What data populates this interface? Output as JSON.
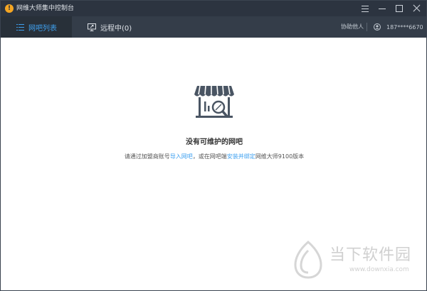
{
  "window": {
    "title": "网维大师集中控制台"
  },
  "tabs": [
    {
      "label": "网吧列表",
      "active": true
    },
    {
      "label": "远程中(0)",
      "active": false
    }
  ],
  "header": {
    "help_label": "协助他人",
    "user_phone": "187****6670"
  },
  "empty_state": {
    "title": "没有可维护的网吧",
    "desc_part1": "请通过加盟商账号",
    "link1": "导入网吧",
    "desc_part2": "，或在网吧端",
    "link2": "安装并绑定",
    "desc_part3": "网维大师9100版本"
  },
  "watermark": {
    "brand": "当下软件园",
    "url": "www.downxia.com"
  },
  "colors": {
    "titlebar": "#2c3440",
    "tabbar": "#343d49",
    "accent": "#3fa1f0"
  }
}
